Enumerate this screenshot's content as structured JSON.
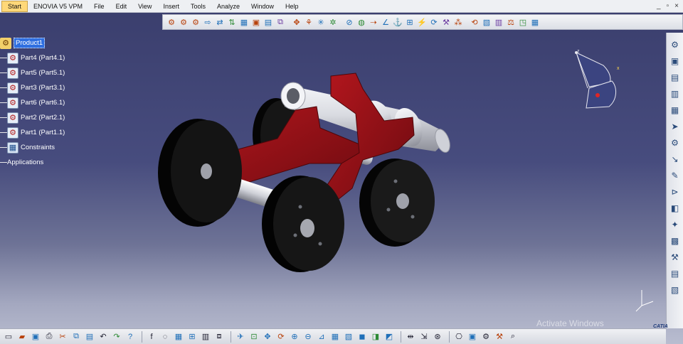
{
  "menu": {
    "start": "Start",
    "items": [
      "ENOVIA V5 VPM",
      "File",
      "Edit",
      "View",
      "Insert",
      "Tools",
      "Analyze",
      "Window",
      "Help"
    ],
    "window_controls": [
      "_",
      "▫",
      "×"
    ]
  },
  "tree": {
    "root": "Product1",
    "children": [
      "Part4 (Part4.1)",
      "Part5 (Part5.1)",
      "Part3 (Part3.1)",
      "Part6 (Part6.1)",
      "Part2 (Part2.1)",
      "Part1 (Part1.1)"
    ],
    "constraints": "Constraints",
    "applications": "Applications"
  },
  "compass": {
    "x_label": "x",
    "z_label": "z"
  },
  "watermark": "Activate Windows",
  "logo": "CATIA",
  "colors": {
    "frame": "#8d1015",
    "wheel": "#0a0a0a",
    "barrel": "#dcdde2",
    "tree_selection": "#2f6fe0"
  }
}
